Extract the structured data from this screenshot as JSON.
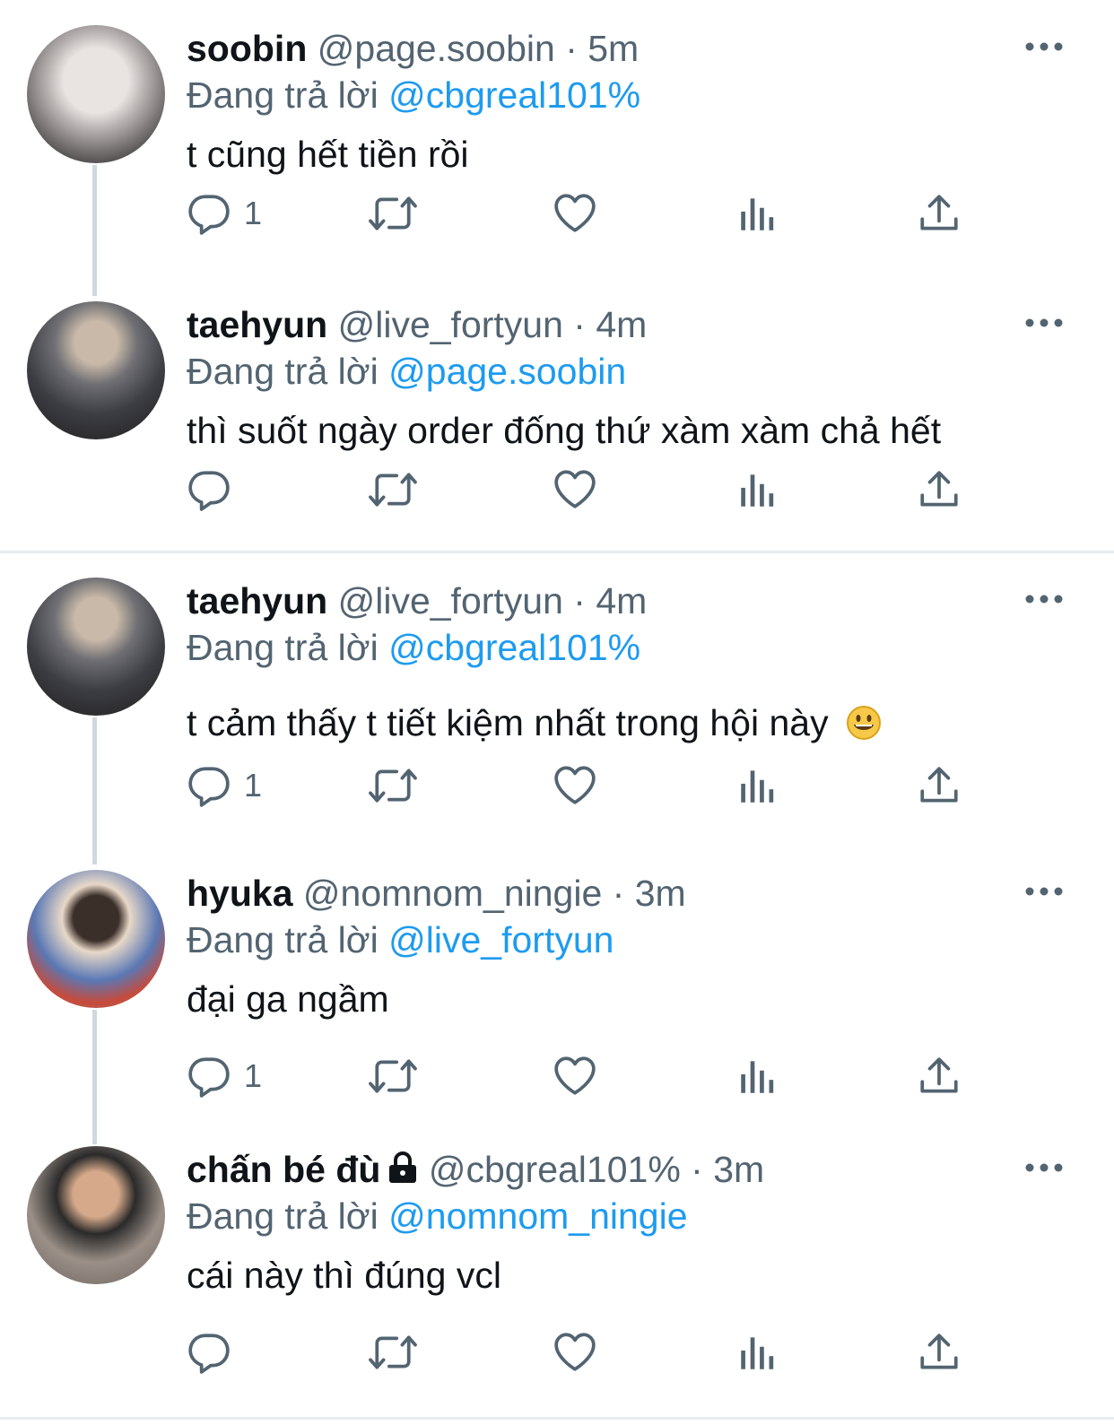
{
  "reply_prefix": "Đang trả lời",
  "tweets": [
    {
      "name": "soobin",
      "meta": "@page.soobin · 5m",
      "reply_to": "@cbgreal101%",
      "text": "t cũng hết tiền rồi",
      "reply_count": "1"
    },
    {
      "name": "taehyun",
      "meta": "@live_fortyun · 4m",
      "reply_to": "@page.soobin",
      "text": "thì suốt ngày order đống thứ xàm xàm chả hết",
      "reply_count": ""
    },
    {
      "name": "taehyun",
      "meta": "@live_fortyun · 4m",
      "reply_to": "@cbgreal101%",
      "text": "t cảm thấy t tiết kiệm nhất trong hội này",
      "reply_count": "1",
      "emoji": "smiling-face-emoji"
    },
    {
      "name": "hyuka",
      "meta": "@nomnom_ningie · 3m",
      "reply_to": "@live_fortyun",
      "text": "đại ga ngầm",
      "reply_count": "1"
    },
    {
      "name": "chấn bé đù",
      "meta": "@cbgreal101% · 3m",
      "reply_to": "@nomnom_ningie",
      "text": "cái này thì đúng vcl",
      "reply_count": "",
      "protected_icon": "lock-icon"
    }
  ],
  "colors": {
    "link": "#1d9bf0",
    "muted": "#536471",
    "text": "#0f1419",
    "thread_line": "#cfd9de",
    "divider": "#e6ecf0"
  }
}
